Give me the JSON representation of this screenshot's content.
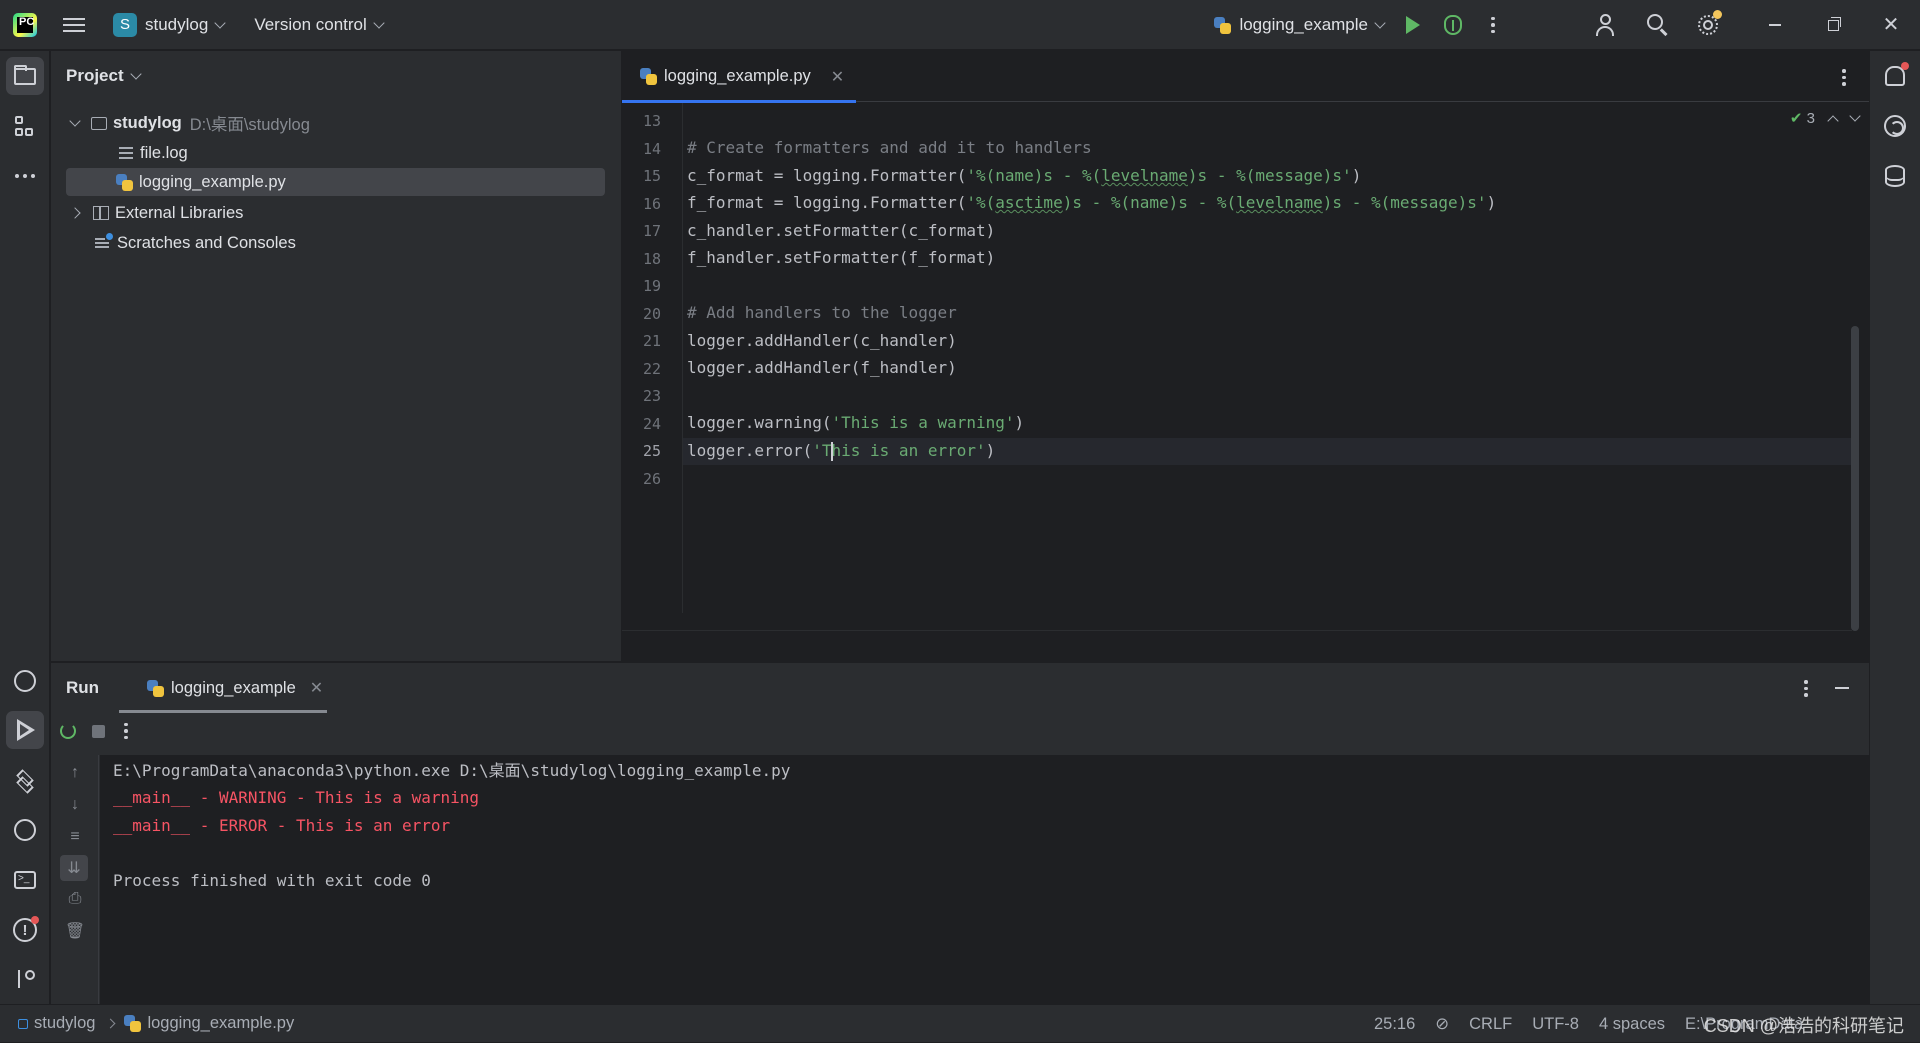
{
  "titlebar": {
    "project_badge": "S",
    "project_name": "studylog",
    "vcs_menu": "Version control",
    "run_config": "logging_example"
  },
  "project_panel": {
    "title": "Project",
    "tree": {
      "root_name": "studylog",
      "root_path": "D:\\桌面\\studylog",
      "file1": "file.log",
      "file2": "logging_example.py",
      "external_libraries": "External Libraries",
      "scratches": "Scratches and Consoles"
    }
  },
  "editor": {
    "tab_label": "logging_example.py",
    "inspection_count": "3",
    "lines": [
      {
        "num": "13"
      },
      {
        "num": "14",
        "comment": "# Create formatters and add it to handlers"
      },
      {
        "num": "15",
        "a": "c_format = logging.Formatter(",
        "s1": "'%(name)s - %(",
        "u1": "levelname",
        "s2": ")s - %(message)s'",
        "b": ")"
      },
      {
        "num": "16",
        "a": "f_format = logging.Formatter(",
        "s1": "'%(",
        "u1": "asctime",
        "s2": ")s - %(name)s - %(",
        "u2": "levelname",
        "s3": ")s - %(message)s'",
        "b": ")"
      },
      {
        "num": "17",
        "text": "c_handler.setFormatter(c_format)"
      },
      {
        "num": "18",
        "text": "f_handler.setFormatter(f_format)"
      },
      {
        "num": "19"
      },
      {
        "num": "20",
        "comment": "# Add handlers to the logger"
      },
      {
        "num": "21",
        "text": "logger.addHandler(c_handler)"
      },
      {
        "num": "22",
        "text": "logger.addHandler(f_handler)"
      },
      {
        "num": "23"
      },
      {
        "num": "24",
        "a": "logger.warning(",
        "s1": "'This is a warning'",
        "b": ")"
      },
      {
        "num": "25",
        "a": "logger.error(",
        "s1": "'T",
        "s2": "his is an error'",
        "b": ")"
      },
      {
        "num": "26"
      }
    ]
  },
  "run_panel": {
    "title": "Run",
    "tab_label": "logging_example",
    "console": {
      "cmd": "E:\\ProgramData\\anaconda3\\python.exe D:\\桌面\\studylog\\logging_example.py",
      "warn": "__main__ - WARNING - This is a warning",
      "error": "__main__ - ERROR - This is an error",
      "exit": "Process finished with exit code 0"
    }
  },
  "statusbar": {
    "project": "studylog",
    "file": "logging_example.py",
    "position": "25:16",
    "line_sep": "CRLF",
    "encoding": "UTF-8",
    "indent": "4 spaces",
    "interpreter_path": "E:\\ProgramData",
    "watermark": "CSDN @浩浩的科研笔记"
  },
  "colors": {
    "accent": "#3574f0",
    "run_green": "#5fb865",
    "string": "#6aab73",
    "error_red": "#f75464"
  }
}
